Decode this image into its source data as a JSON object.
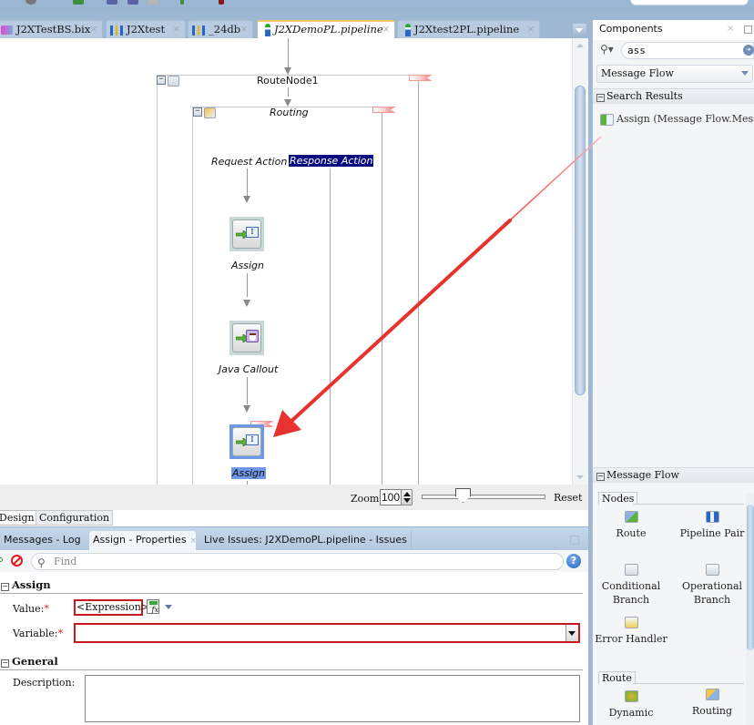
{
  "editor_tabs": [
    {
      "label": "J2XTestBS.bix",
      "icon": "business-service-icon",
      "active": false
    },
    {
      "label": "J2Xtest",
      "icon": "composite-icon",
      "active": false
    },
    {
      "label": "_24db",
      "icon": "composite-icon",
      "active": false
    },
    {
      "label": "J2XDemoPL.pipeline",
      "icon": "pipeline-icon",
      "active": true
    },
    {
      "label": "J2Xtest2PL.pipeline",
      "icon": "pipeline-icon",
      "active": false
    }
  ],
  "tab_close_glyph": "×",
  "diagram": {
    "route_node": "RouteNode1",
    "routing": "Routing",
    "request_action": "Request Action",
    "response_action": "Response Action",
    "actions": [
      {
        "label": "Assign",
        "icon": "assign-icon",
        "selected": false
      },
      {
        "label": "Java Callout",
        "icon": "java-callout-icon",
        "selected": false
      },
      {
        "label": "Assign",
        "icon": "assign-icon",
        "selected": true
      }
    ],
    "highlight_color": "#0a0a80",
    "selection_color": "#6e97e6"
  },
  "zoom": {
    "label": "Zoom:",
    "value": "100",
    "reset_label": "Reset"
  },
  "view_tabs": [
    {
      "label": "Design",
      "active": true
    },
    {
      "label": "Configuration",
      "active": false
    }
  ],
  "properties_tabs": [
    {
      "label": "Messages - Log",
      "active": false
    },
    {
      "label": "Assign - Properties",
      "active": true
    },
    {
      "label": "Live Issues: J2XDemoPL.pipeline - Issues",
      "active": false
    }
  ],
  "properties": {
    "find_placeholder": "Find",
    "help_glyph": "?",
    "sections": {
      "assign": "Assign",
      "general": "General"
    },
    "value_label": "Value:",
    "value_expression": "<Expression>",
    "variable_label": "Variable:",
    "variable_value": "",
    "required_mark": "*",
    "description_label": "Description:",
    "description_value": "",
    "error_color": "#c7191f"
  },
  "components": {
    "title": "Components",
    "close_glyph": "×",
    "search_value": "ass",
    "category": "Message Flow",
    "search_results_header": "Search Results",
    "search_results": [
      "Assign (Message Flow.Mess"
    ],
    "palette_header": "Message Flow",
    "groups": [
      {
        "name": "Nodes",
        "items": [
          {
            "label": "Route",
            "icon": "route-icon"
          },
          {
            "label": "Pipeline Pair",
            "icon": "pipeline-pair-icon"
          },
          {
            "label": "Conditional Branch",
            "icon": "conditional-branch-icon"
          },
          {
            "label": "Operational Branch",
            "icon": "operational-branch-icon"
          },
          {
            "label": "Error Handler",
            "icon": "error-handler-icon"
          }
        ]
      },
      {
        "name": "Route",
        "items": [
          {
            "label": "Dynamic",
            "icon": "dynamic-routing-icon"
          },
          {
            "label": "Routing",
            "icon": "routing-icon"
          }
        ]
      }
    ]
  },
  "annotation_color": "#e8322f"
}
